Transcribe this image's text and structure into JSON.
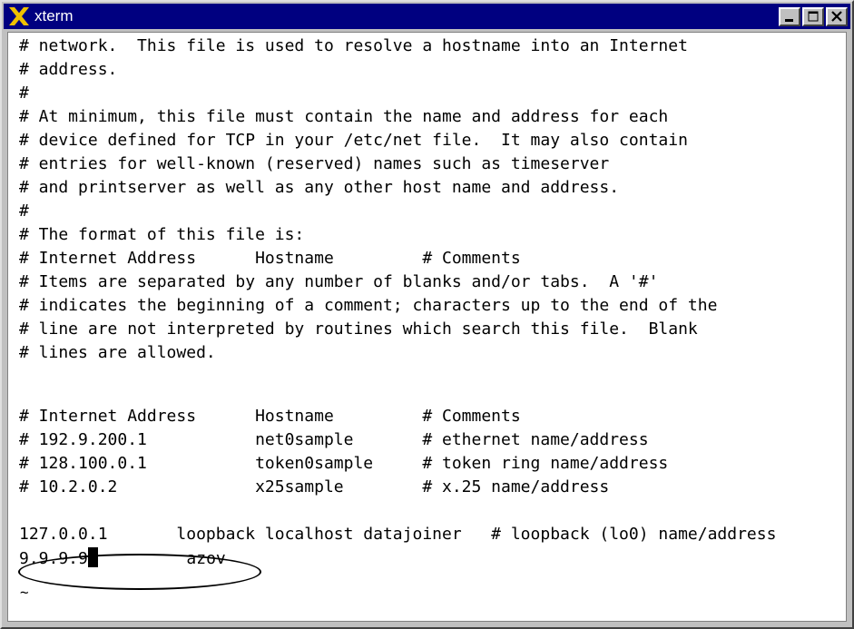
{
  "window": {
    "title": "xterm",
    "controls": [
      "minimize",
      "maximize",
      "close"
    ]
  },
  "terminal": {
    "lines": [
      "# network.  This file is used to resolve a hostname into an Internet",
      "# address.",
      "#",
      "# At minimum, this file must contain the name and address for each",
      "# device defined for TCP in your /etc/net file.  It may also contain",
      "# entries for well-known (reserved) names such as timeserver",
      "# and printserver as well as any other host name and address.",
      "#",
      "# The format of this file is:",
      "# Internet Address      Hostname         # Comments",
      "# Items are separated by any number of blanks and/or tabs.  A '#'",
      "# indicates the beginning of a comment; characters up to the end of the",
      "# line are not interpreted by routines which search this file.  Blank",
      "# lines are allowed.",
      "",
      "# Internet Address      Hostname         # Comments",
      "# 192.9.200.1           net0sample       # ethernet name/address",
      "# 128.100.0.1           token0sample     # token ring name/address",
      "# 10.2.0.2              x25sample        # x.25 name/address",
      "",
      "127.0.0.1       loopback localhost datajoiner   # loopback (lo0) name/address"
    ],
    "edit_line": {
      "before_cursor": "9.9.9.9",
      "after_cursor": "         azov"
    },
    "empty_marker": "~"
  },
  "icons": {
    "app": "x-logo-icon",
    "minimize": "minimize-icon",
    "maximize": "maximize-icon",
    "close": "close-icon"
  },
  "colors": {
    "titlebar": "#000080",
    "logo": "#f0c000",
    "background": "#ffffff",
    "text": "#000000"
  }
}
